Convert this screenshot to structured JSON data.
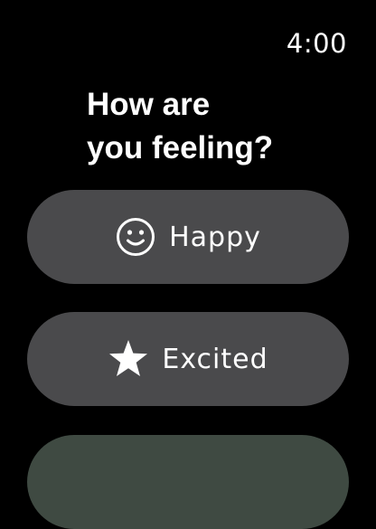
{
  "status": {
    "time": "4:00"
  },
  "prompt": {
    "line1": "How are",
    "line2": "you feeling?"
  },
  "options": [
    {
      "label": "Happy",
      "icon": "smiley-face-icon"
    },
    {
      "label": "Excited",
      "icon": "star-icon"
    },
    {
      "label": "",
      "icon": ""
    }
  ],
  "colors": {
    "background": "#000000",
    "button": "#4a4a4c",
    "text": "#ffffff",
    "partial_button": "#3f4a42"
  }
}
